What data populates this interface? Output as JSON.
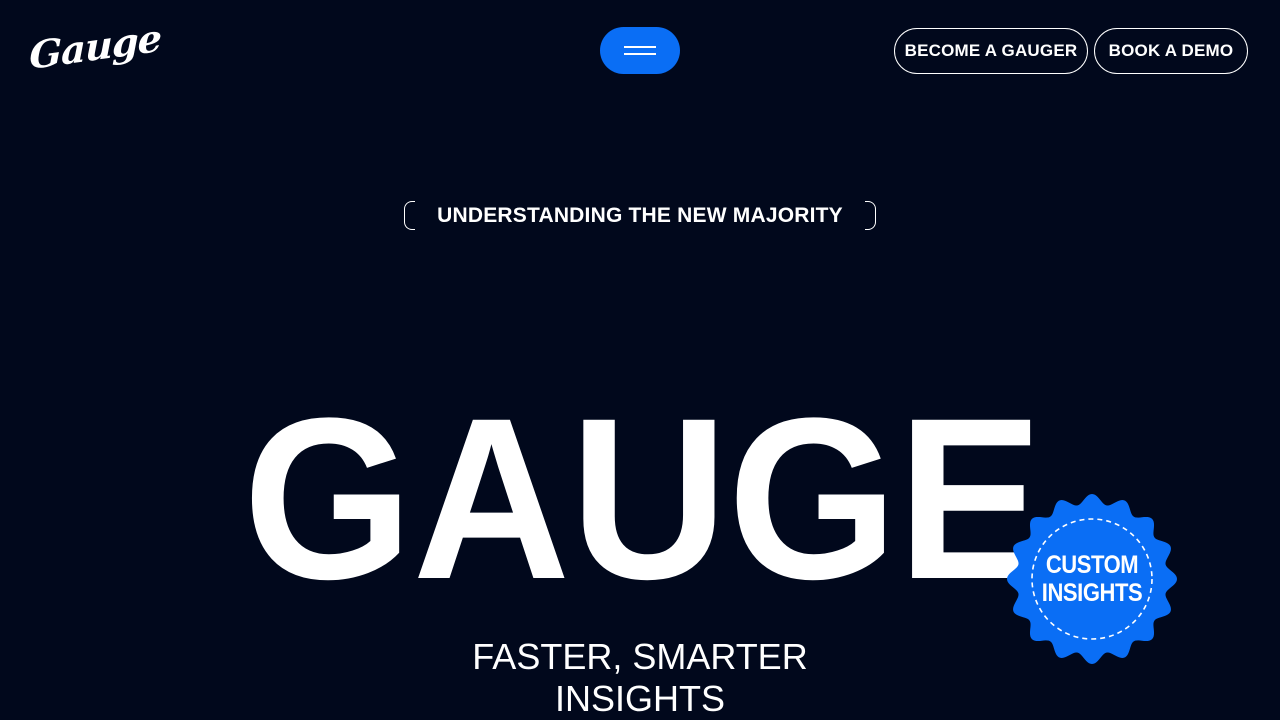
{
  "header": {
    "logo": "Gauge",
    "menu_icon": "hamburger-icon",
    "become_gauger_label": "BECOME A GAUGER",
    "book_demo_label": "BOOK A DEMO"
  },
  "hero": {
    "eyebrow": "UNDERSTANDING THE NEW MAJORITY",
    "title": "GAUGE",
    "badge_line1": "CUSTOM",
    "badge_line2": "INSIGHTS",
    "tagline_line1": "FASTER, SMARTER",
    "tagline_line2": "INSIGHTS"
  },
  "colors": {
    "background": "#01081c",
    "accent": "#0a6ef5",
    "text": "#ffffff"
  }
}
